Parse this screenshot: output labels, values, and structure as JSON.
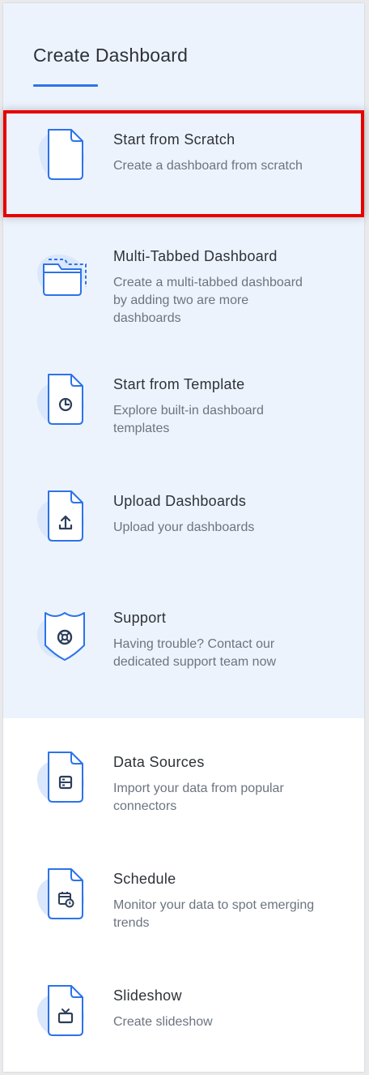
{
  "header": {
    "title": "Create Dashboard"
  },
  "items": [
    {
      "title": "Start from Scratch",
      "description": "Create a dashboard from scratch",
      "icon": "document-icon"
    },
    {
      "title": "Multi-Tabbed Dashboard",
      "description": "Create a multi-tabbed dashboard by adding two are more dashboards",
      "icon": "folder-tabs-icon"
    },
    {
      "title": "Start from Template",
      "description": "Explore built-in dashboard templates",
      "icon": "template-clock-icon"
    },
    {
      "title": "Upload Dashboards",
      "description": "Upload your dashboards",
      "icon": "upload-icon"
    },
    {
      "title": "Support",
      "description": "Having trouble? Contact our dedicated support team now",
      "icon": "support-shield-icon"
    },
    {
      "title": "Data Sources",
      "description": "Import your data from popular connectors",
      "icon": "data-source-icon"
    },
    {
      "title": "Schedule",
      "description": "Monitor your data to spot emerging trends",
      "icon": "schedule-calendar-icon"
    },
    {
      "title": "Slideshow",
      "description": "Create slideshow",
      "icon": "slideshow-tv-icon"
    }
  ],
  "colors": {
    "accent": "#2c73ea",
    "selection_border": "#e60000",
    "tint_background": "#edf3fd",
    "icon_blob": "#dbe7fb"
  }
}
